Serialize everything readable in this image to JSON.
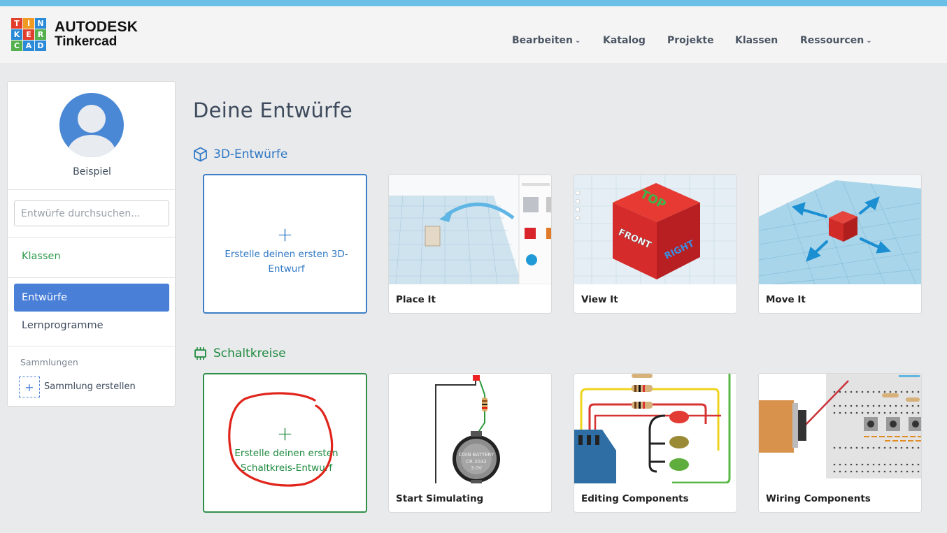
{
  "header": {
    "logo_letters": [
      "T",
      "I",
      "N",
      "K",
      "E",
      "R",
      "C",
      "A",
      "D"
    ],
    "brand_line1": "AUTODESK",
    "brand_line2": "Tinkercad",
    "nav": [
      {
        "label": "Bearbeiten",
        "dropdown": true
      },
      {
        "label": "Katalog",
        "dropdown": false
      },
      {
        "label": "Projekte",
        "dropdown": false
      },
      {
        "label": "Klassen",
        "dropdown": false
      },
      {
        "label": "Ressourcen",
        "dropdown": true
      }
    ]
  },
  "sidebar": {
    "username": "Beispiel",
    "search_placeholder": "Entwürfe durchsuchen...",
    "links": {
      "classes": "Klassen",
      "designs": "Entwürfe",
      "tutorials": "Lernprogramme"
    },
    "collections_heading": "Sammlungen",
    "add_collection_icon": "+",
    "add_collection_label": "Sammlung erstellen"
  },
  "main": {
    "title": "Deine Entwürfe",
    "sections": {
      "designs_3d": {
        "heading": "3D-Entwürfe",
        "create_label": "Erstelle deinen ersten 3D-Entwurf",
        "plus": "+",
        "cards": [
          "Place It",
          "View It",
          "Move It"
        ]
      },
      "circuits": {
        "heading": "Schaltkreise",
        "create_label": "Erstelle deinen ersten Schaltkreis-Entwurf",
        "plus": "+",
        "cards": [
          "Start Simulating",
          "Editing Components",
          "Wiring Components"
        ]
      }
    },
    "thumb_text": {
      "cube_top": "TOP",
      "cube_front": "FRONT",
      "cube_right": "RIGHT",
      "battery_line1": "COIN BATTERY",
      "battery_line2": "CR 2032",
      "battery_line3": "3.0V"
    }
  },
  "colors": {
    "accent_blue": "#4a7fd8",
    "section_3d": "#2f78c4",
    "section_circuits": "#1e8a3e",
    "annotation_red": "#e0241b",
    "topbar": "#6cc0e8"
  },
  "icons": {
    "section_3d": "cube-icon",
    "section_circuits": "chip-icon",
    "nav_dropdown": "chevron-down-icon"
  }
}
